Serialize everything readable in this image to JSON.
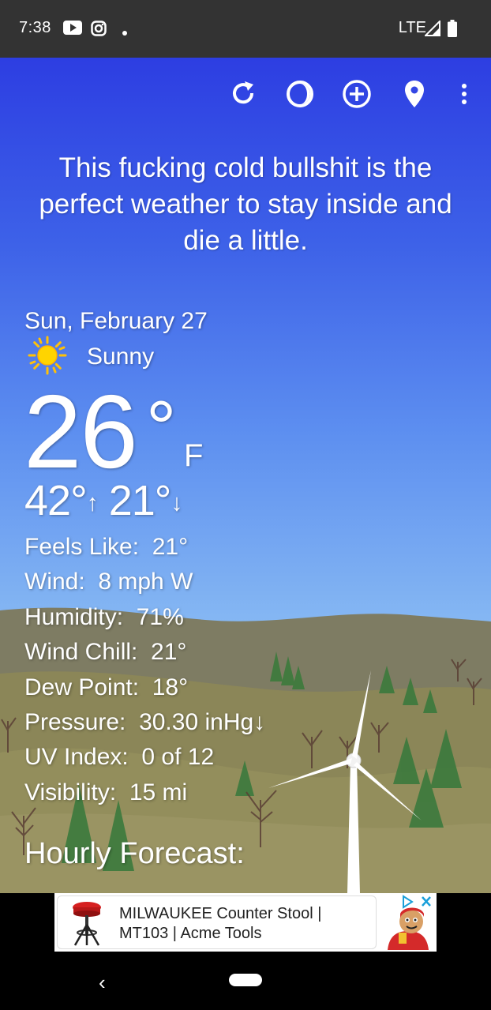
{
  "status_bar": {
    "time": "7:38",
    "network": "LTE",
    "icons": [
      "youtube-icon",
      "instagram-icon",
      "notification-dot-icon",
      "signal-icon",
      "battery-icon"
    ]
  },
  "toolbar": {
    "actions": [
      "refresh-icon",
      "theme-icon",
      "add-location-icon",
      "location-pin-icon",
      "more-options-icon"
    ]
  },
  "quote": "This fucking cold bullshit is the perfect weather to stay inside and die a little.",
  "weather": {
    "date": "Sun, February 27",
    "condition": "Sunny",
    "condition_icon": "sun-icon",
    "temperature": "26",
    "degree_symbol": "°",
    "unit": "F",
    "high": "42°",
    "low": "21°",
    "high_arrow": "↑",
    "low_arrow": "↓",
    "details": [
      {
        "label": "Feels Like:",
        "value": "21°"
      },
      {
        "label": "Wind:",
        "value": "8 mph W"
      },
      {
        "label": "Humidity:",
        "value": "71%"
      },
      {
        "label": "Wind Chill:",
        "value": "21°"
      },
      {
        "label": "Dew Point:",
        "value": "18°"
      },
      {
        "label": "Pressure:",
        "value": "30.30 inHg↓"
      },
      {
        "label": "UV Index:",
        "value": "0 of 12"
      },
      {
        "label": "Visibility:",
        "value": "15 mi"
      }
    ],
    "hourly_title": "Hourly Forecast:"
  },
  "ad": {
    "text_line1": "MILWAUKEE Counter Stool |",
    "text_line2": "MT103 | Acme Tools"
  },
  "nav": {
    "back": "‹"
  },
  "colors": {
    "status_bar": "#333333",
    "sky_top": "#2d3ee2",
    "sky_bottom": "#a7cff6",
    "hill_far": "#7c7a62",
    "hill_near": "#8f8a5a",
    "tree_green": "#3f7a3e",
    "text": "#ffffff"
  }
}
